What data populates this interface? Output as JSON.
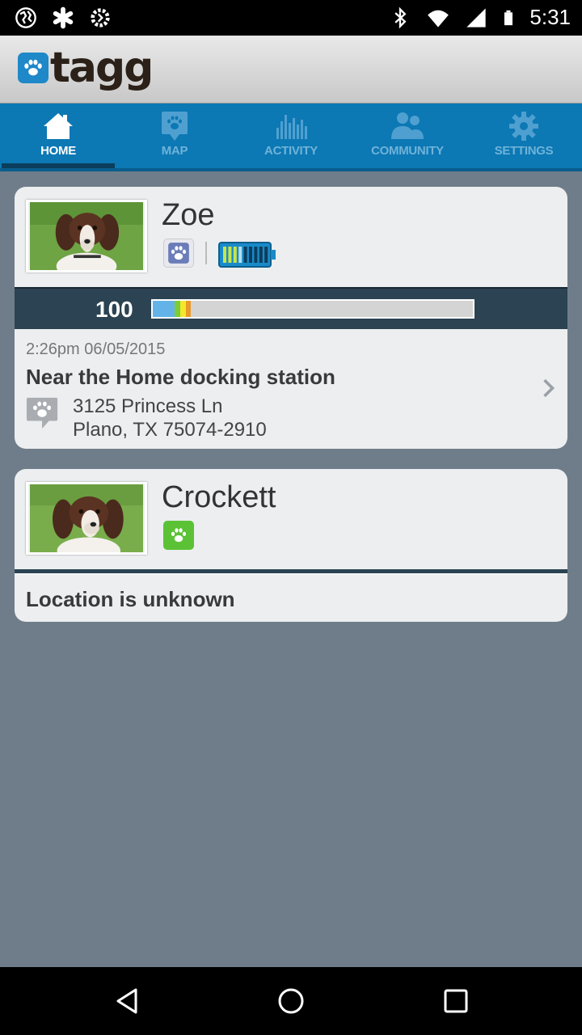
{
  "status_bar": {
    "time": "5:31",
    "left_icons": [
      "globe-icon",
      "asterisk-icon",
      "tasker-icon"
    ],
    "right_icons": [
      "bluetooth-icon",
      "wifi-icon",
      "signal-icon",
      "battery-icon"
    ]
  },
  "app": {
    "logo_text": "tagg"
  },
  "nav": {
    "tabs": [
      {
        "label": "HOME",
        "icon": "home-icon",
        "active": true
      },
      {
        "label": "MAP",
        "icon": "map-pin-icon",
        "active": false
      },
      {
        "label": "ACTIVITY",
        "icon": "activity-icon",
        "active": false
      },
      {
        "label": "COMMUNITY",
        "icon": "community-icon",
        "active": false
      },
      {
        "label": "SETTINGS",
        "icon": "gear-icon",
        "active": false
      }
    ]
  },
  "pets": [
    {
      "name": "Zoe",
      "tracker_color": "#6b7db8",
      "battery_level": 1.0,
      "activity_value": "100",
      "activity_fraction": 0.12,
      "timestamp": "2:26pm 06/05/2015",
      "location_title": "Near the Home docking station",
      "address_line1": "3125 Princess Ln",
      "address_line2": "Plano, TX 75074-2910"
    },
    {
      "name": "Crockett",
      "tracker_color": "#5bc236",
      "location_title": "Location is unknown"
    }
  ],
  "colors": {
    "accent": "#0c78b4",
    "background": "#6f7d8a",
    "bar": "#2b4352"
  }
}
